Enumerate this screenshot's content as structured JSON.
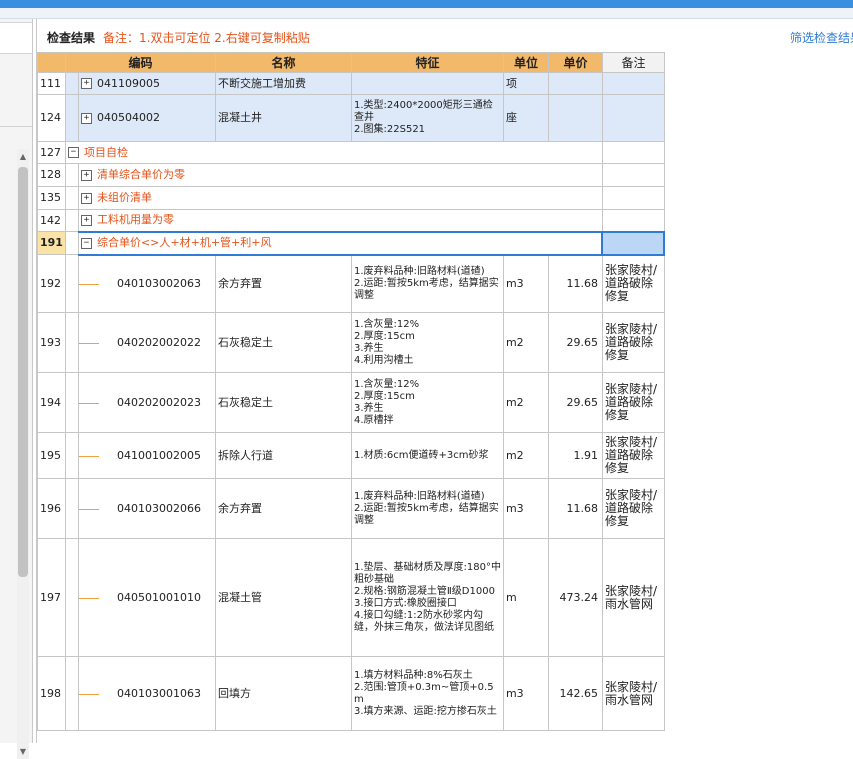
{
  "header": {
    "title": "检查结果",
    "note": "备注：1.双击可定位 2.右键可复制粘贴",
    "filter_link": "筛选检查结果"
  },
  "columns": {
    "code": "编码",
    "name": "名称",
    "feature": "特征",
    "unit": "单位",
    "price": "单价",
    "remark": "备注"
  },
  "top_rows": [
    {
      "row": "111",
      "code": "041109005",
      "name": "不断交施工增加费",
      "feature": "",
      "unit": "项",
      "price": "",
      "remark": ""
    },
    {
      "row": "124",
      "code": "040504002",
      "name": "混凝土井",
      "feature": "1.类型:2400*2000矩形三通检查井\n2.图集:22S521",
      "unit": "座",
      "price": "",
      "remark": ""
    }
  ],
  "groups": [
    {
      "row": "127",
      "label": "项目自检",
      "toggle": "−"
    },
    {
      "row": "128",
      "label": "清单综合单价为零",
      "toggle": "+"
    },
    {
      "row": "135",
      "label": "未组价清单",
      "toggle": "+"
    },
    {
      "row": "142",
      "label": "工料机用量为零",
      "toggle": "+"
    },
    {
      "row": "191",
      "label": "综合单价<>人+材+机+管+利+风",
      "toggle": "−"
    }
  ],
  "items": [
    {
      "row": "192",
      "code": "040103002063",
      "name": "余方弃置",
      "feature": "1.废弃料品种:旧路材料(道碴)\n2.运距:暂按5km考虑，结算据实调整",
      "unit": "m3",
      "price": "11.68",
      "remark": "张家陵村/道路破除修复"
    },
    {
      "row": "193",
      "code": "040202002022",
      "name": "石灰稳定土",
      "feature": "1.含灰量:12%\n2.厚度:15cm\n3.养生\n4.利用沟槽土",
      "unit": "m2",
      "price": "29.65",
      "remark": "张家陵村/道路破除修复"
    },
    {
      "row": "194",
      "code": "040202002023",
      "name": "石灰稳定土",
      "feature": "1.含灰量:12%\n2.厚度:15cm\n3.养生\n4.原槽拌",
      "unit": "m2",
      "price": "29.65",
      "remark": "张家陵村/道路破除修复"
    },
    {
      "row": "195",
      "code": "041001002005",
      "name": "拆除人行道",
      "feature": "1.材质:6cm便道砖+3cm砂浆",
      "unit": "m2",
      "price": "1.91",
      "remark": "张家陵村/道路破除修复"
    },
    {
      "row": "196",
      "code": "040103002066",
      "name": "余方弃置",
      "feature": "1.废弃料品种:旧路材料(道碴)\n2.运距:暂按5km考虑，结算据实调整",
      "unit": "m3",
      "price": "11.68",
      "remark": "张家陵村/道路破除修复"
    },
    {
      "row": "197",
      "code": "040501001010",
      "name": "混凝土管",
      "feature": "1.垫层、基础材质及厚度:180°中粗砂基础\n2.规格:钢筋混凝土管Ⅱ级D1000\n3.接口方式:橡胶圈接口\n4.接口勾缝:1:2防水砂浆内勾缝，外抹三角灰，做法详见图纸",
      "unit": "m",
      "price": "473.24",
      "remark": "张家陵村/雨水管网"
    },
    {
      "row": "198",
      "code": "040103001063",
      "name": "回填方",
      "feature": "1.填方材料品种:8%石灰土\n2.范围:管顶+0.3m~管顶+0.5m\n3.填方来源、运距:挖方掺石灰土",
      "unit": "m3",
      "price": "142.65",
      "remark": "张家陵村/雨水管网"
    }
  ],
  "colors": {
    "accent": "#3b8fe0",
    "header_orange": "#f2b96b",
    "note_orange": "#e5531a",
    "link_blue": "#2f7bd6",
    "row_blue": "#dde9f8",
    "selection": "#2f7bd6"
  }
}
